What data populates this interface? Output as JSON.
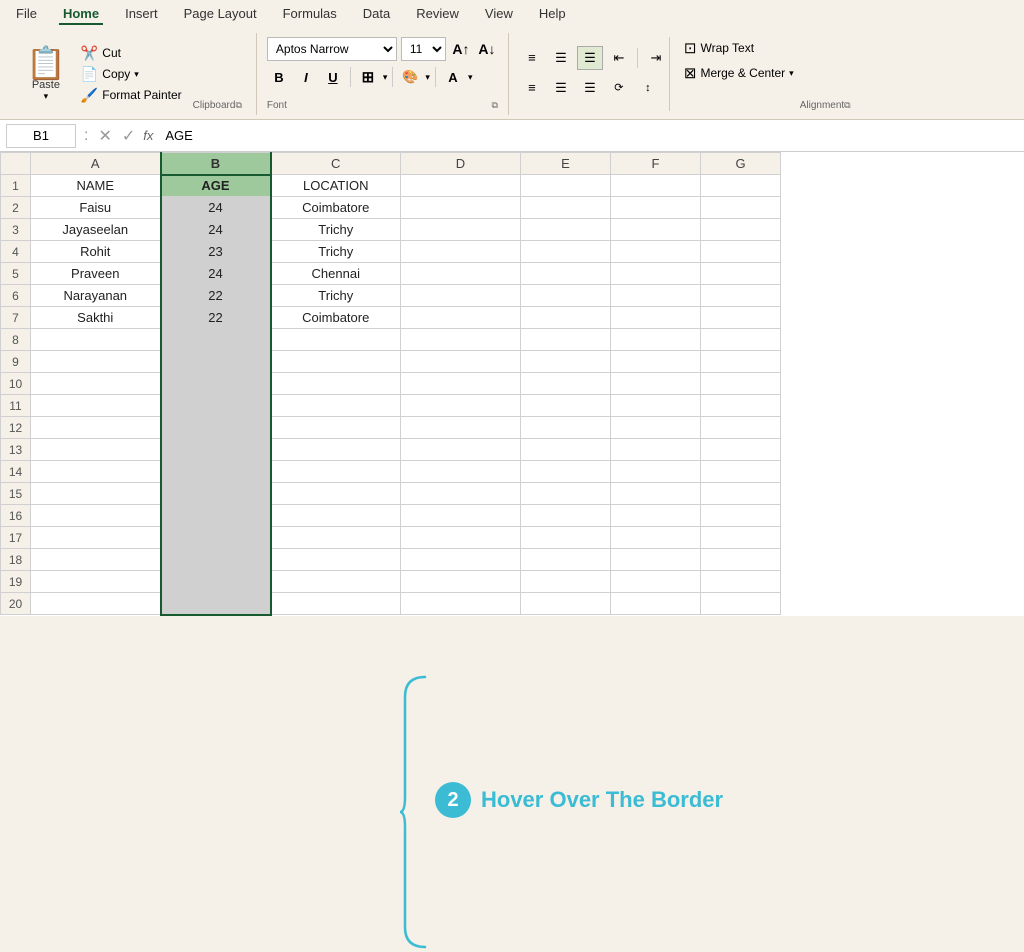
{
  "menu": {
    "items": [
      "File",
      "Home",
      "Insert",
      "Page Layout",
      "Formulas",
      "Data",
      "Review",
      "View",
      "Help"
    ],
    "active": "Home"
  },
  "ribbon": {
    "clipboard": {
      "paste_label": "Paste",
      "paste_arrow": "▾",
      "cut_label": "Cut",
      "copy_label": "Copy",
      "copy_arrow": "▾",
      "format_painter_label": "Format Painter",
      "group_label": "Clipboard"
    },
    "font": {
      "font_name": "Aptos Narrow",
      "font_size": "11",
      "bold_label": "B",
      "italic_label": "I",
      "underline_label": "U",
      "group_label": "Font"
    },
    "alignment": {
      "wrap_text_label": "Wrap Text",
      "merge_center_label": "Merge & Center",
      "group_label": "Alignment"
    }
  },
  "formula_bar": {
    "cell_ref": "B1",
    "formula_value": "AGE"
  },
  "columns": [
    "A",
    "B",
    "C",
    "D",
    "E",
    "F",
    "G"
  ],
  "rows": [
    {
      "row": 1,
      "a": "NAME",
      "b": "AGE",
      "c": "LOCATION"
    },
    {
      "row": 2,
      "a": "Faisu",
      "b": "24",
      "c": "Coimbatore"
    },
    {
      "row": 3,
      "a": "Jayaseelan",
      "b": "24",
      "c": "Trichy"
    },
    {
      "row": 4,
      "a": "Rohit",
      "b": "23",
      "c": "Trichy"
    },
    {
      "row": 5,
      "a": "Praveen",
      "b": "24",
      "c": "Chennai"
    },
    {
      "row": 6,
      "a": "Narayanan",
      "b": "22",
      "c": "Trichy"
    },
    {
      "row": 7,
      "a": "Sakthi",
      "b": "22",
      "c": "Coimbatore"
    },
    {
      "row": 8,
      "a": "",
      "b": "",
      "c": ""
    },
    {
      "row": 9,
      "a": "",
      "b": "",
      "c": ""
    },
    {
      "row": 10,
      "a": "",
      "b": "",
      "c": ""
    },
    {
      "row": 11,
      "a": "",
      "b": "",
      "c": ""
    },
    {
      "row": 12,
      "a": "",
      "b": "",
      "c": ""
    },
    {
      "row": 13,
      "a": "",
      "b": "",
      "c": ""
    },
    {
      "row": 14,
      "a": "",
      "b": "",
      "c": ""
    },
    {
      "row": 15,
      "a": "",
      "b": "",
      "c": ""
    },
    {
      "row": 16,
      "a": "",
      "b": "",
      "c": ""
    },
    {
      "row": 17,
      "a": "",
      "b": "",
      "c": ""
    },
    {
      "row": 18,
      "a": "",
      "b": "",
      "c": ""
    },
    {
      "row": 19,
      "a": "",
      "b": "",
      "c": ""
    },
    {
      "row": 20,
      "a": "",
      "b": "",
      "c": ""
    }
  ],
  "annotation": {
    "badge_number": "2",
    "text": "Hover Over The Border"
  }
}
